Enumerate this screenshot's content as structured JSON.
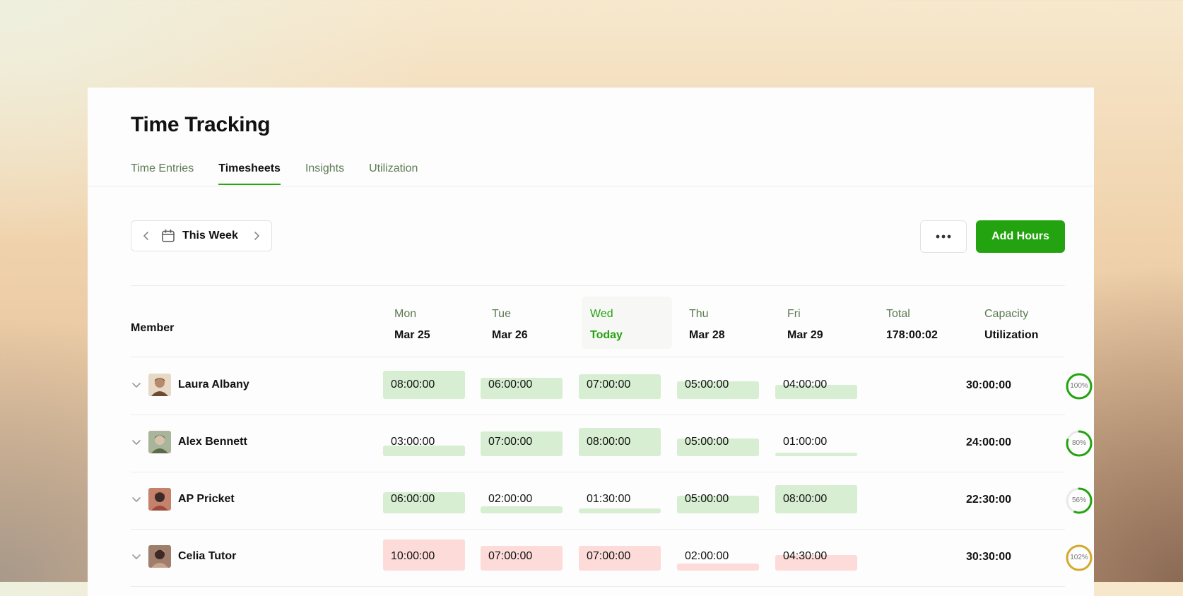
{
  "header": {
    "title": "Time Tracking"
  },
  "tabs": [
    {
      "label": "Time Entries",
      "active": false
    },
    {
      "label": "Timesheets",
      "active": true
    },
    {
      "label": "Insights",
      "active": false
    },
    {
      "label": "Utilization",
      "active": false
    }
  ],
  "toolbar": {
    "week_label": "This Week",
    "add_label": "Add Hours",
    "more_label": "•••"
  },
  "colors": {
    "accent": "#23a30f",
    "under_fill": "#d7eed2",
    "over_fill": "#fcdbd9",
    "gauge_green": "#23a30f",
    "gauge_gold": "#d4a92b"
  },
  "table": {
    "member_header": "Member",
    "days": [
      {
        "dow": "Mon",
        "date": "Mar 25",
        "today": false
      },
      {
        "dow": "Tue",
        "date": "Mar 26",
        "today": false
      },
      {
        "dow": "Wed",
        "date": "Today",
        "today": true
      },
      {
        "dow": "Thu",
        "date": "Mar 28",
        "today": false
      },
      {
        "dow": "Fri",
        "date": "Mar 29",
        "today": false
      }
    ],
    "total_header": {
      "top": "Total",
      "value": "178:00:02"
    },
    "capacity_header": {
      "top": "Capacity",
      "bottom": "Utilization"
    },
    "rows": [
      {
        "name": "Laura Albany",
        "avatar_icon": "avatar-laura",
        "cells": [
          {
            "value": "08:00:00",
            "hours": 8,
            "status": "normal"
          },
          {
            "value": "06:00:00",
            "hours": 6,
            "status": "normal"
          },
          {
            "value": "07:00:00",
            "hours": 7,
            "status": "normal"
          },
          {
            "value": "05:00:00",
            "hours": 5,
            "status": "normal"
          },
          {
            "value": "04:00:00",
            "hours": 4,
            "status": "normal"
          }
        ],
        "total": "30:00:00",
        "utilization": {
          "label": "100%",
          "percent": 100,
          "color": "#23a30f"
        }
      },
      {
        "name": "Alex Bennett",
        "avatar_icon": "avatar-alex",
        "cells": [
          {
            "value": "03:00:00",
            "hours": 3,
            "status": "normal"
          },
          {
            "value": "07:00:00",
            "hours": 7,
            "status": "normal"
          },
          {
            "value": "08:00:00",
            "hours": 8,
            "status": "normal"
          },
          {
            "value": "05:00:00",
            "hours": 5,
            "status": "normal"
          },
          {
            "value": "01:00:00",
            "hours": 1,
            "status": "normal"
          }
        ],
        "total": "24:00:00",
        "utilization": {
          "label": "80%",
          "percent": 80,
          "color": "#23a30f"
        }
      },
      {
        "name": "AP Pricket",
        "avatar_icon": "avatar-ap",
        "cells": [
          {
            "value": "06:00:00",
            "hours": 6,
            "status": "normal"
          },
          {
            "value": "02:00:00",
            "hours": 2,
            "status": "normal"
          },
          {
            "value": "01:30:00",
            "hours": 1.5,
            "status": "normal"
          },
          {
            "value": "05:00:00",
            "hours": 5,
            "status": "normal"
          },
          {
            "value": "08:00:00",
            "hours": 8,
            "status": "normal"
          }
        ],
        "total": "22:30:00",
        "utilization": {
          "label": "56%",
          "percent": 56,
          "color": "#23a30f"
        }
      },
      {
        "name": "Celia Tutor",
        "avatar_icon": "avatar-celia",
        "cells": [
          {
            "value": "10:00:00",
            "hours": 10,
            "status": "over"
          },
          {
            "value": "07:00:00",
            "hours": 7,
            "status": "over"
          },
          {
            "value": "07:00:00",
            "hours": 7,
            "status": "over"
          },
          {
            "value": "02:00:00",
            "hours": 2,
            "status": "over"
          },
          {
            "value": "04:30:00",
            "hours": 4.5,
            "status": "over"
          }
        ],
        "total": "30:30:00",
        "utilization": {
          "label": "102%",
          "percent": 102,
          "color": "#d4a92b"
        }
      }
    ]
  }
}
